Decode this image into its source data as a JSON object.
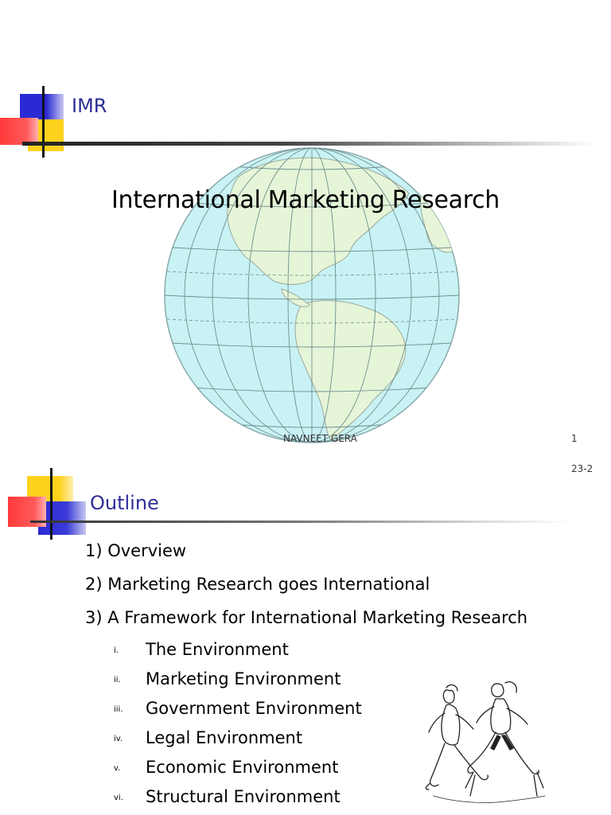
{
  "slide1": {
    "header_title": "IMR",
    "title": "International Marketing Research",
    "footer_author": "NAVNEET GERA",
    "page_number": "1",
    "globe_icon": "globe-americas-icon",
    "colors": {
      "header": "#2e2e99",
      "globe_sea": "#c9f2f5",
      "globe_land": "#e6f5d8"
    }
  },
  "slide2": {
    "corner_label": "23-2",
    "header_title": "Outline",
    "items": [
      "1) Overview",
      "2) Marketing Research goes International",
      "3) A Framework for International Marketing Research"
    ],
    "subitems": [
      {
        "num": "i.",
        "label": "The Environment"
      },
      {
        "num": "ii.",
        "label": "Marketing Environment"
      },
      {
        "num": "iii.",
        "label": "Government Environment"
      },
      {
        "num": "iv.",
        "label": "Legal Environment"
      },
      {
        "num": "v.",
        "label": "Economic Environment"
      },
      {
        "num": "vi.",
        "label": "Structural Environment"
      }
    ],
    "illustration_icon": "runners-sketch-icon"
  },
  "logo_colors": {
    "blue": "#2a2ad4",
    "yellow": "#ffd21e",
    "red": "#ff3a3a"
  }
}
